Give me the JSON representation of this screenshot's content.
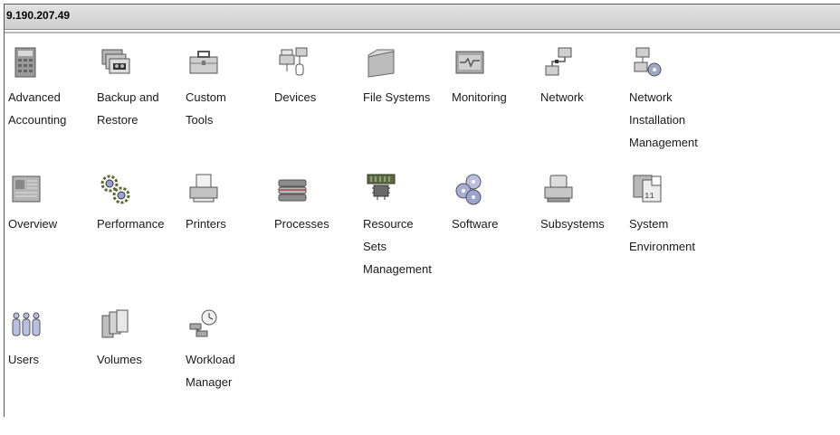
{
  "window": {
    "title": "9.190.207.49"
  },
  "items": [
    {
      "icon": "calculator-icon",
      "lines": [
        "Advanced",
        "Accounting"
      ]
    },
    {
      "icon": "tape-backup-icon",
      "lines": [
        "Backup and",
        "Restore"
      ]
    },
    {
      "icon": "toolbox-icon",
      "lines": [
        "Custom",
        "Tools"
      ]
    },
    {
      "icon": "devices-icon",
      "lines": [
        "Devices"
      ]
    },
    {
      "icon": "folder-icon",
      "lines": [
        "File Systems"
      ]
    },
    {
      "icon": "monitor-icon",
      "lines": [
        "Monitoring"
      ]
    },
    {
      "icon": "network-icon",
      "lines": [
        "Network"
      ]
    },
    {
      "icon": "network-install-icon",
      "lines": [
        "Network",
        "Installation",
        "Management"
      ]
    },
    {
      "icon": "overview-icon",
      "lines": [
        "Overview"
      ]
    },
    {
      "icon": "gears-icon",
      "lines": [
        "Performance"
      ]
    },
    {
      "icon": "printer-icon",
      "lines": [
        "Printers"
      ]
    },
    {
      "icon": "processes-icon",
      "lines": [
        "Processes"
      ]
    },
    {
      "icon": "chip-icon",
      "lines": [
        "Resource",
        "Sets",
        "Management"
      ]
    },
    {
      "icon": "software-discs-icon",
      "lines": [
        "Software"
      ]
    },
    {
      "icon": "subsystems-icon",
      "lines": [
        "Subsystems"
      ]
    },
    {
      "icon": "calendar-icon",
      "lines": [
        "System",
        "Environment"
      ]
    },
    {
      "icon": "users-icon",
      "lines": [
        "Users"
      ]
    },
    {
      "icon": "volumes-icon",
      "lines": [
        "Volumes"
      ]
    },
    {
      "icon": "workload-icon",
      "lines": [
        "Workload",
        "Manager"
      ]
    }
  ]
}
